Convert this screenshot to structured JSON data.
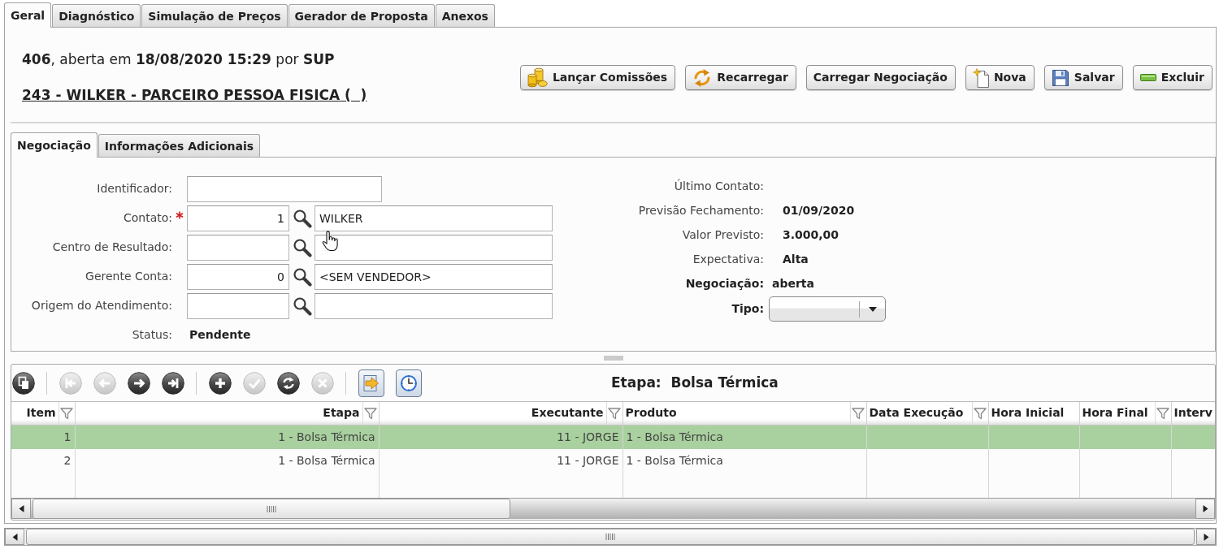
{
  "tabs": [
    {
      "label": "Geral",
      "selected": true
    },
    {
      "label": "Diagnóstico",
      "selected": false
    },
    {
      "label": "Simulação de Preços",
      "selected": false
    },
    {
      "label": "Gerador de Proposta",
      "selected": false
    },
    {
      "label": "Anexos",
      "selected": false
    }
  ],
  "header": {
    "summary": "**406**, aberta em **18/08/2020 15:29** por **SUP**",
    "partner_link": "243 - WILKER - PARCEIRO PESSOA FISICA (  )"
  },
  "actions": [
    {
      "label": "Lançar Comissões",
      "kind": "coins"
    },
    {
      "label": "Recarregar",
      "kind": "reload"
    },
    {
      "label": "Carregar Negociação",
      "kind": "plain"
    },
    {
      "label": "Nova",
      "kind": "new"
    },
    {
      "label": "Salvar",
      "kind": "save"
    },
    {
      "label": "Excluir",
      "kind": "delete"
    }
  ],
  "sub_tabs": [
    {
      "label": "Negociação",
      "selected": true
    },
    {
      "label": "Informações Adicionais",
      "selected": false
    }
  ],
  "form_left": [
    {
      "label": "Identificador:",
      "kind": "text",
      "required": false
    },
    {
      "label": "Contato:",
      "kind": "lookup",
      "required": true,
      "code": "1",
      "name": "WILKER"
    },
    {
      "label": "Centro de Resultado:",
      "kind": "lookup",
      "required": false
    },
    {
      "label": "Gerente Conta:",
      "kind": "lookup",
      "required": false,
      "code": "0",
      "name": "<SEM VENDEDOR>"
    },
    {
      "label": "Origem do Atendimento:",
      "kind": "lookup",
      "required": false
    },
    {
      "label": "Status:",
      "kind": "value",
      "required": false,
      "value": "Pendente"
    }
  ],
  "form_right": [
    {
      "label": "Último Contato:",
      "kind": "value"
    },
    {
      "label": "Previsão Fechamento:",
      "kind": "value",
      "value": "01/09/2020"
    },
    {
      "label": "Valor Previsto:",
      "kind": "value",
      "value": "3.000,00"
    },
    {
      "label": "Expectativa:",
      "kind": "value",
      "value": "Alta"
    },
    {
      "label": "Negociação:",
      "kind": "status",
      "value": "aberta"
    },
    {
      "label": "Tipo:",
      "kind": "select"
    }
  ],
  "grid": {
    "toolbar": {
      "groups": [
        {
          "buttons": [
            {
              "kind": "copy",
              "disabled": false
            }
          ]
        },
        {
          "buttons": [
            {
              "kind": "first",
              "disabled": true
            },
            {
              "kind": "previous",
              "disabled": true
            },
            {
              "kind": "next",
              "disabled": false
            },
            {
              "kind": "last",
              "disabled": false
            }
          ]
        },
        {
          "buttons": [
            {
              "kind": "add",
              "disabled": false
            },
            {
              "kind": "confirm",
              "disabled": true
            },
            {
              "kind": "refresh",
              "disabled": false
            },
            {
              "kind": "cancel",
              "disabled": true
            }
          ]
        },
        {
          "buttons": [
            {
              "kind": "export",
              "disabled": false
            },
            {
              "kind": "schedule",
              "disabled": false
            }
          ]
        }
      ]
    },
    "stage_title": "Etapa:  Bolsa Térmica",
    "table": {
      "columns": [
        {
          "label": "Item",
          "kind": "right",
          "filter": true
        },
        {
          "label": "Etapa",
          "kind": "right",
          "filter": true
        },
        {
          "label": "Executante",
          "kind": "right",
          "filter": true
        },
        {
          "label": "Produto",
          "kind": "left",
          "filter": true
        },
        {
          "label": "Data Execução",
          "kind": "left",
          "filter": true
        },
        {
          "label": "Hora Inicial",
          "kind": "left",
          "filter": false
        },
        {
          "label": "Hora Final",
          "kind": "left",
          "filter": true
        },
        {
          "label": "Interv",
          "kind": "left",
          "filter": false
        }
      ],
      "rows": [
        {
          "selected": true,
          "cells": [
            "1",
            "1 - Bolsa Térmica",
            "11 - JORGE",
            "1 - Bolsa Térmica"
          ]
        },
        {
          "selected": false,
          "cells": [
            "2",
            "1 - Bolsa Térmica",
            "11 - JORGE",
            "1 - Bolsa Térmica"
          ]
        }
      ]
    }
  }
}
